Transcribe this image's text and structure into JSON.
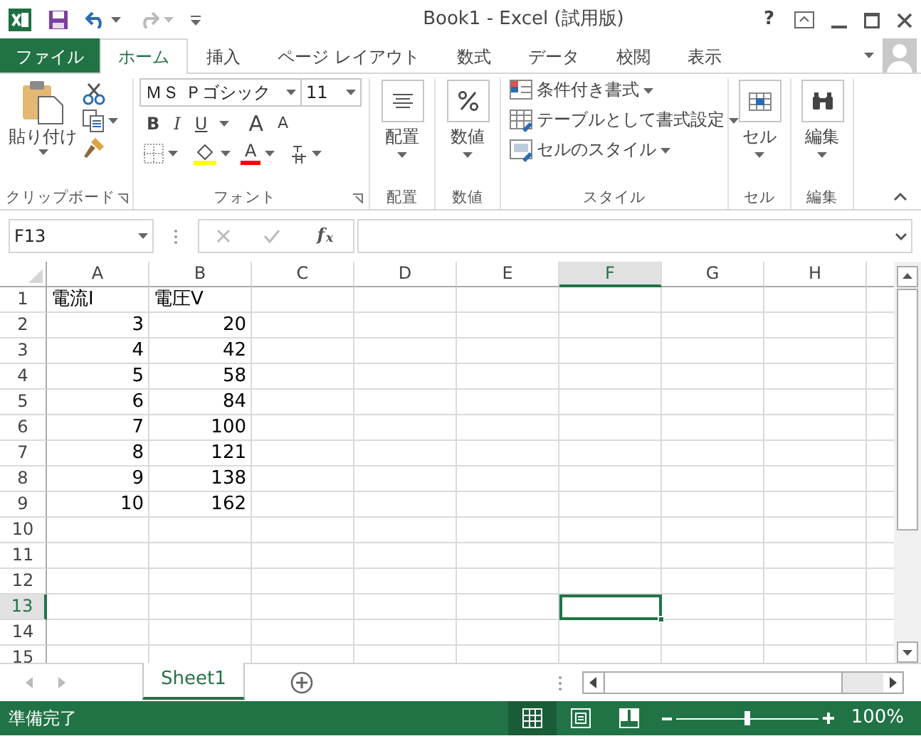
{
  "title_bar": {
    "title": "Book1 - Excel (試用版)",
    "help": "?"
  },
  "tabs": [
    {
      "label": "ファイル",
      "kind": "file",
      "selected": false
    },
    {
      "label": "ホーム",
      "kind": "tab",
      "selected": true
    },
    {
      "label": "挿入",
      "kind": "tab",
      "selected": false
    },
    {
      "label": "ページ レイアウト",
      "kind": "tab",
      "selected": false
    },
    {
      "label": "数式",
      "kind": "tab",
      "selected": false
    },
    {
      "label": "データ",
      "kind": "tab",
      "selected": false
    },
    {
      "label": "校閲",
      "kind": "tab",
      "selected": false
    },
    {
      "label": "表示",
      "kind": "tab",
      "selected": false
    }
  ],
  "ribbon": {
    "clipboard": {
      "paste": "貼り付け",
      "label": "クリップボード"
    },
    "font": {
      "name": "ＭＳ Ｐゴシック",
      "size": "11",
      "bold": "B",
      "italic": "I",
      "underline": "U",
      "grow": "A",
      "shrink": "A",
      "font_color": "A",
      "label": "フォント"
    },
    "alignment": {
      "button": "配置",
      "label": "配置"
    },
    "number": {
      "button": "数値",
      "label": "数値"
    },
    "styles": {
      "items": [
        "条件付き書式",
        "テーブルとして書式設定",
        "セルのスタイル"
      ],
      "label": "スタイル"
    },
    "cells": {
      "button": "セル",
      "label": "セル"
    },
    "editing": {
      "button": "編集",
      "label": "編集"
    }
  },
  "formula_bar": {
    "name_box": "F13",
    "function_label": "f$_{x}$"
  },
  "grid": {
    "columns": [
      {
        "label": "A",
        "selected": false
      },
      {
        "label": "B",
        "selected": false
      },
      {
        "label": "C",
        "selected": false
      },
      {
        "label": "D",
        "selected": false
      },
      {
        "label": "E",
        "selected": false
      },
      {
        "label": "F",
        "selected": true
      },
      {
        "label": "G",
        "selected": false
      },
      {
        "label": "H",
        "selected": false
      }
    ],
    "rows": [
      {
        "label": "1",
        "selected": false,
        "cells": [
          {
            "text": "電流I",
            "kind": "text"
          },
          {
            "text": "電圧V",
            "kind": "text"
          }
        ]
      },
      {
        "label": "2",
        "selected": false,
        "cells": [
          {
            "text": "3",
            "kind": "number"
          },
          {
            "text": "20",
            "kind": "number"
          }
        ]
      },
      {
        "label": "3",
        "selected": false,
        "cells": [
          {
            "text": "4",
            "kind": "number"
          },
          {
            "text": "42",
            "kind": "number"
          }
        ]
      },
      {
        "label": "4",
        "selected": false,
        "cells": [
          {
            "text": "5",
            "kind": "number"
          },
          {
            "text": "58",
            "kind": "number"
          }
        ]
      },
      {
        "label": "5",
        "selected": false,
        "cells": [
          {
            "text": "6",
            "kind": "number"
          },
          {
            "text": "84",
            "kind": "number"
          }
        ]
      },
      {
        "label": "6",
        "selected": false,
        "cells": [
          {
            "text": "7",
            "kind": "number"
          },
          {
            "text": "100",
            "kind": "number"
          }
        ]
      },
      {
        "label": "7",
        "selected": false,
        "cells": [
          {
            "text": "8",
            "kind": "number"
          },
          {
            "text": "121",
            "kind": "number"
          }
        ]
      },
      {
        "label": "8",
        "selected": false,
        "cells": [
          {
            "text": "9",
            "kind": "number"
          },
          {
            "text": "138",
            "kind": "number"
          }
        ]
      },
      {
        "label": "9",
        "selected": false,
        "cells": [
          {
            "text": "10",
            "kind": "number"
          },
          {
            "text": "162",
            "kind": "number"
          }
        ]
      },
      {
        "label": "10",
        "selected": false
      },
      {
        "label": "11",
        "selected": false
      },
      {
        "label": "12",
        "selected": false
      },
      {
        "label": "13",
        "selected": true
      },
      {
        "label": "14",
        "selected": false
      },
      {
        "label": "15",
        "selected": false
      }
    ]
  },
  "sheet_tabs": [
    {
      "label": "Sheet1",
      "selected": true
    }
  ],
  "status_bar": {
    "status": "準備完了",
    "views": [
      {
        "kind": "normal",
        "selected": true
      },
      {
        "kind": "page_layout",
        "selected": false
      },
      {
        "kind": "page_break",
        "selected": false
      }
    ],
    "zoom": {
      "level": 0.5,
      "reading": "100%"
    }
  }
}
